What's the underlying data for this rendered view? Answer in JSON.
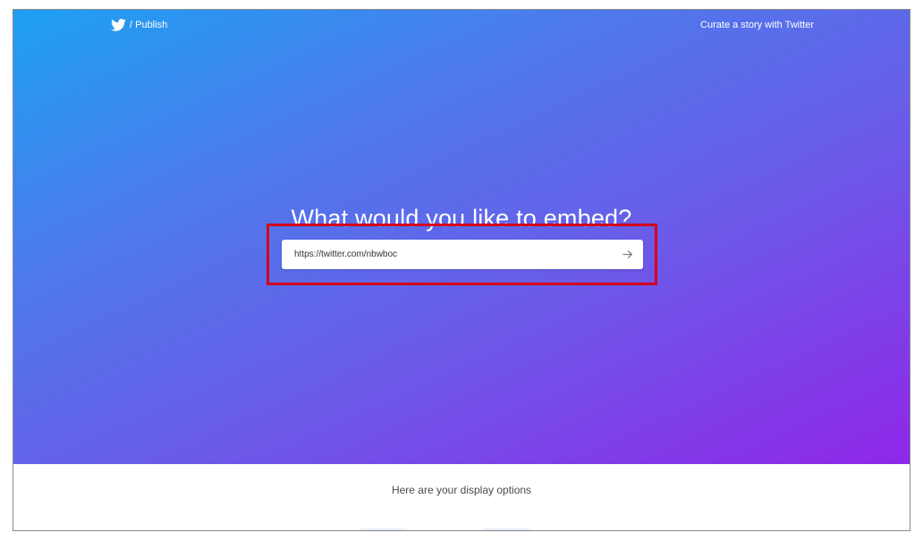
{
  "header": {
    "brand_text": "/ Publish",
    "brand_icon": "twitter-bird-icon",
    "curate_link": "Curate a story with Twitter"
  },
  "hero": {
    "headline": "What would you like to embed?",
    "url_input_value": "https://twitter.com/nbwboc",
    "submit_icon": "arrow-right-icon"
  },
  "options": {
    "title": "Here are your display options"
  },
  "colors": {
    "gradient_start": "#1da1f2",
    "gradient_end": "#8f27e8",
    "highlight": "#d4001a"
  }
}
